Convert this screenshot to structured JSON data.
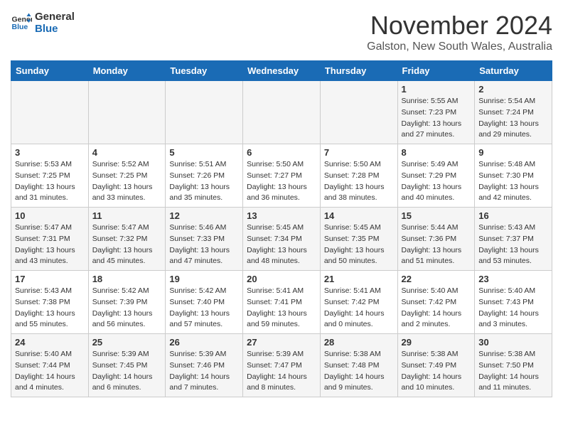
{
  "logo": {
    "line1": "General",
    "line2": "Blue"
  },
  "title": "November 2024",
  "location": "Galston, New South Wales, Australia",
  "days_of_week": [
    "Sunday",
    "Monday",
    "Tuesday",
    "Wednesday",
    "Thursday",
    "Friday",
    "Saturday"
  ],
  "weeks": [
    [
      {
        "day": "",
        "sunrise": "",
        "sunset": "",
        "daylight": ""
      },
      {
        "day": "",
        "sunrise": "",
        "sunset": "",
        "daylight": ""
      },
      {
        "day": "",
        "sunrise": "",
        "sunset": "",
        "daylight": ""
      },
      {
        "day": "",
        "sunrise": "",
        "sunset": "",
        "daylight": ""
      },
      {
        "day": "",
        "sunrise": "",
        "sunset": "",
        "daylight": ""
      },
      {
        "day": "1",
        "sunrise": "Sunrise: 5:55 AM",
        "sunset": "Sunset: 7:23 PM",
        "daylight": "Daylight: 13 hours and 27 minutes."
      },
      {
        "day": "2",
        "sunrise": "Sunrise: 5:54 AM",
        "sunset": "Sunset: 7:24 PM",
        "daylight": "Daylight: 13 hours and 29 minutes."
      }
    ],
    [
      {
        "day": "3",
        "sunrise": "Sunrise: 5:53 AM",
        "sunset": "Sunset: 7:25 PM",
        "daylight": "Daylight: 13 hours and 31 minutes."
      },
      {
        "day": "4",
        "sunrise": "Sunrise: 5:52 AM",
        "sunset": "Sunset: 7:25 PM",
        "daylight": "Daylight: 13 hours and 33 minutes."
      },
      {
        "day": "5",
        "sunrise": "Sunrise: 5:51 AM",
        "sunset": "Sunset: 7:26 PM",
        "daylight": "Daylight: 13 hours and 35 minutes."
      },
      {
        "day": "6",
        "sunrise": "Sunrise: 5:50 AM",
        "sunset": "Sunset: 7:27 PM",
        "daylight": "Daylight: 13 hours and 36 minutes."
      },
      {
        "day": "7",
        "sunrise": "Sunrise: 5:50 AM",
        "sunset": "Sunset: 7:28 PM",
        "daylight": "Daylight: 13 hours and 38 minutes."
      },
      {
        "day": "8",
        "sunrise": "Sunrise: 5:49 AM",
        "sunset": "Sunset: 7:29 PM",
        "daylight": "Daylight: 13 hours and 40 minutes."
      },
      {
        "day": "9",
        "sunrise": "Sunrise: 5:48 AM",
        "sunset": "Sunset: 7:30 PM",
        "daylight": "Daylight: 13 hours and 42 minutes."
      }
    ],
    [
      {
        "day": "10",
        "sunrise": "Sunrise: 5:47 AM",
        "sunset": "Sunset: 7:31 PM",
        "daylight": "Daylight: 13 hours and 43 minutes."
      },
      {
        "day": "11",
        "sunrise": "Sunrise: 5:47 AM",
        "sunset": "Sunset: 7:32 PM",
        "daylight": "Daylight: 13 hours and 45 minutes."
      },
      {
        "day": "12",
        "sunrise": "Sunrise: 5:46 AM",
        "sunset": "Sunset: 7:33 PM",
        "daylight": "Daylight: 13 hours and 47 minutes."
      },
      {
        "day": "13",
        "sunrise": "Sunrise: 5:45 AM",
        "sunset": "Sunset: 7:34 PM",
        "daylight": "Daylight: 13 hours and 48 minutes."
      },
      {
        "day": "14",
        "sunrise": "Sunrise: 5:45 AM",
        "sunset": "Sunset: 7:35 PM",
        "daylight": "Daylight: 13 hours and 50 minutes."
      },
      {
        "day": "15",
        "sunrise": "Sunrise: 5:44 AM",
        "sunset": "Sunset: 7:36 PM",
        "daylight": "Daylight: 13 hours and 51 minutes."
      },
      {
        "day": "16",
        "sunrise": "Sunrise: 5:43 AM",
        "sunset": "Sunset: 7:37 PM",
        "daylight": "Daylight: 13 hours and 53 minutes."
      }
    ],
    [
      {
        "day": "17",
        "sunrise": "Sunrise: 5:43 AM",
        "sunset": "Sunset: 7:38 PM",
        "daylight": "Daylight: 13 hours and 55 minutes."
      },
      {
        "day": "18",
        "sunrise": "Sunrise: 5:42 AM",
        "sunset": "Sunset: 7:39 PM",
        "daylight": "Daylight: 13 hours and 56 minutes."
      },
      {
        "day": "19",
        "sunrise": "Sunrise: 5:42 AM",
        "sunset": "Sunset: 7:40 PM",
        "daylight": "Daylight: 13 hours and 57 minutes."
      },
      {
        "day": "20",
        "sunrise": "Sunrise: 5:41 AM",
        "sunset": "Sunset: 7:41 PM",
        "daylight": "Daylight: 13 hours and 59 minutes."
      },
      {
        "day": "21",
        "sunrise": "Sunrise: 5:41 AM",
        "sunset": "Sunset: 7:42 PM",
        "daylight": "Daylight: 14 hours and 0 minutes."
      },
      {
        "day": "22",
        "sunrise": "Sunrise: 5:40 AM",
        "sunset": "Sunset: 7:42 PM",
        "daylight": "Daylight: 14 hours and 2 minutes."
      },
      {
        "day": "23",
        "sunrise": "Sunrise: 5:40 AM",
        "sunset": "Sunset: 7:43 PM",
        "daylight": "Daylight: 14 hours and 3 minutes."
      }
    ],
    [
      {
        "day": "24",
        "sunrise": "Sunrise: 5:40 AM",
        "sunset": "Sunset: 7:44 PM",
        "daylight": "Daylight: 14 hours and 4 minutes."
      },
      {
        "day": "25",
        "sunrise": "Sunrise: 5:39 AM",
        "sunset": "Sunset: 7:45 PM",
        "daylight": "Daylight: 14 hours and 6 minutes."
      },
      {
        "day": "26",
        "sunrise": "Sunrise: 5:39 AM",
        "sunset": "Sunset: 7:46 PM",
        "daylight": "Daylight: 14 hours and 7 minutes."
      },
      {
        "day": "27",
        "sunrise": "Sunrise: 5:39 AM",
        "sunset": "Sunset: 7:47 PM",
        "daylight": "Daylight: 14 hours and 8 minutes."
      },
      {
        "day": "28",
        "sunrise": "Sunrise: 5:38 AM",
        "sunset": "Sunset: 7:48 PM",
        "daylight": "Daylight: 14 hours and 9 minutes."
      },
      {
        "day": "29",
        "sunrise": "Sunrise: 5:38 AM",
        "sunset": "Sunset: 7:49 PM",
        "daylight": "Daylight: 14 hours and 10 minutes."
      },
      {
        "day": "30",
        "sunrise": "Sunrise: 5:38 AM",
        "sunset": "Sunset: 7:50 PM",
        "daylight": "Daylight: 14 hours and 11 minutes."
      }
    ]
  ]
}
